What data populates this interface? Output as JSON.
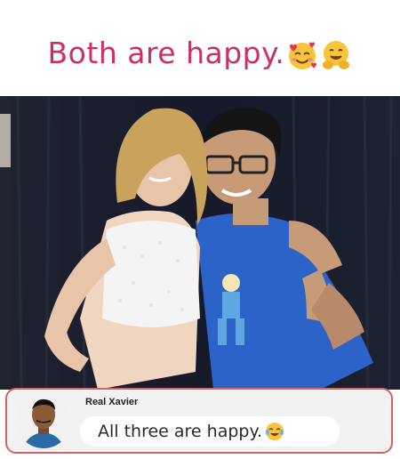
{
  "caption": {
    "text": "Both are happy.",
    "emojis": [
      "smiling-face-with-hearts-icon",
      "hugging-face-icon"
    ],
    "color": "#cc2f66"
  },
  "photo": {
    "shirt_color": "#2c63c9",
    "backdrop_color": "#1a1e2c"
  },
  "comment": {
    "author": "Real Xavier",
    "text": "All three are happy.",
    "emoji": "laughing-tears-icon",
    "border_color": "#d26464"
  }
}
